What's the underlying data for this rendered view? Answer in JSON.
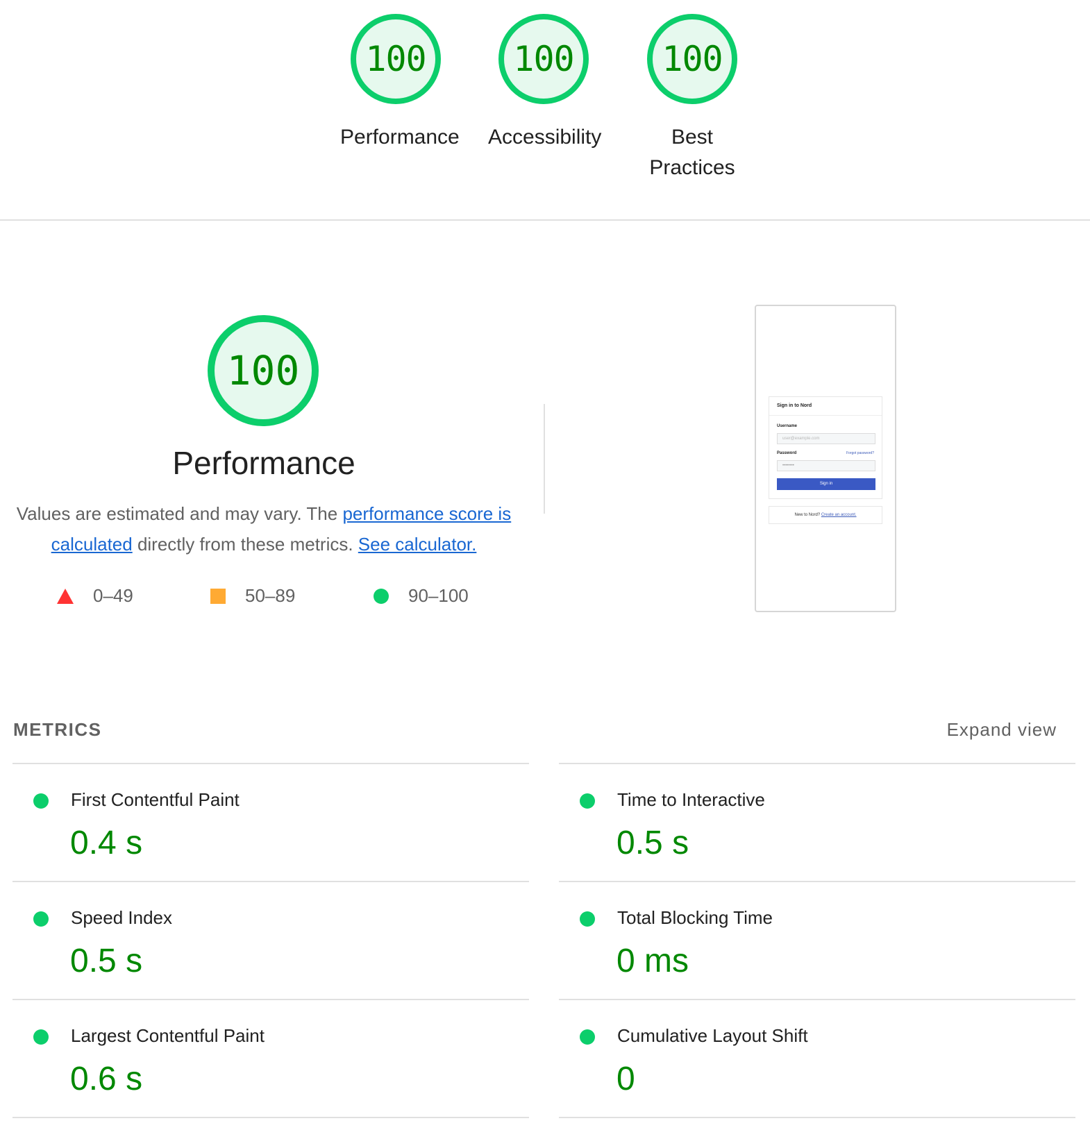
{
  "colors": {
    "pass": "#0cce6b",
    "pass_text": "#008800",
    "pass_bg": "#e6f9ee",
    "average": "#ffaa33",
    "fail": "#ff3333",
    "link": "#1967d2"
  },
  "gauges": [
    {
      "score": "100",
      "label": "Performance"
    },
    {
      "score": "100",
      "label": "Accessibility"
    },
    {
      "score": "100",
      "label": "Best Practices"
    }
  ],
  "performance": {
    "score": "100",
    "title": "Performance",
    "desc_text_1": "Values are estimated and may vary. The ",
    "desc_link_1": "performance score is calculated",
    "desc_text_2": " directly from these metrics. ",
    "desc_link_2": "See calculator.",
    "legend": [
      {
        "icon": "triangle-icon",
        "range": "0–49"
      },
      {
        "icon": "square-icon",
        "range": "50–89"
      },
      {
        "icon": "circle-icon",
        "range": "90–100"
      }
    ]
  },
  "screenshot": {
    "heading": "Sign in to Nord",
    "username_label": "Username",
    "username_placeholder": "user@example.com",
    "password_label": "Password",
    "forgot_link": "Forgot password?",
    "password_value": "••••••••",
    "signin_button": "Sign in",
    "footer_text": "New to Nord? ",
    "footer_link": "Create an account."
  },
  "metrics": {
    "heading": "METRICS",
    "toggle": "Expand view",
    "left": [
      {
        "title": "First Contentful Paint",
        "value": "0.4 s"
      },
      {
        "title": "Speed Index",
        "value": "0.5 s"
      },
      {
        "title": "Largest Contentful Paint",
        "value": "0.6 s"
      }
    ],
    "right": [
      {
        "title": "Time to Interactive",
        "value": "0.5 s"
      },
      {
        "title": "Total Blocking Time",
        "value": "0 ms"
      },
      {
        "title": "Cumulative Layout Shift",
        "value": "0"
      }
    ]
  }
}
